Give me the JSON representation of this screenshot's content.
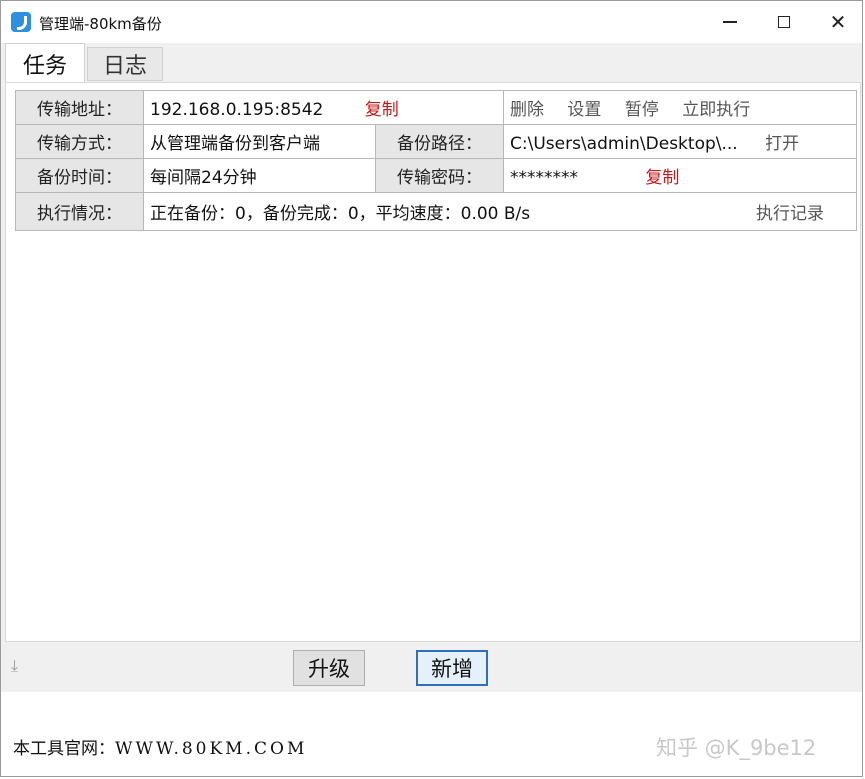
{
  "window": {
    "title": "管理端-80km备份"
  },
  "window_controls": {
    "minimize": "",
    "maximize": "",
    "close": "✕"
  },
  "tabs": [
    {
      "label": "任务"
    },
    {
      "label": "日志"
    }
  ],
  "task": {
    "address_label": "传输地址：",
    "address_value": "192.168.0.195:8542",
    "copy_address": "复制",
    "actions": {
      "delete": "删除",
      "settings": "设置",
      "pause": "暂停",
      "run_now": "立即执行"
    },
    "mode_label": "传输方式：",
    "mode_value": "从管理端备份到客户端",
    "path_label": "备份路径：",
    "path_value": "C:\\Users\\admin\\Desktop\\...",
    "open": "打开",
    "time_label": "备份时间：",
    "time_value": "每间隔24分钟",
    "password_label": "传输密码：",
    "password_value": "********",
    "copy_password": "复制",
    "status_label": "执行情况：",
    "status_value": "正在备份：0，备份完成：0，平均速度：0.00 B/s",
    "log_link": "执行记录"
  },
  "bottom": {
    "upgrade": "升级",
    "new": "新增"
  },
  "footer": {
    "site_prefix": "本工具官网：",
    "site_url": "WWW.80KM.COM",
    "watermark": "知乎 @K_9be12"
  },
  "colors": {
    "accent_red": "#c21a1a",
    "button_focus": "#2f6fb4"
  }
}
